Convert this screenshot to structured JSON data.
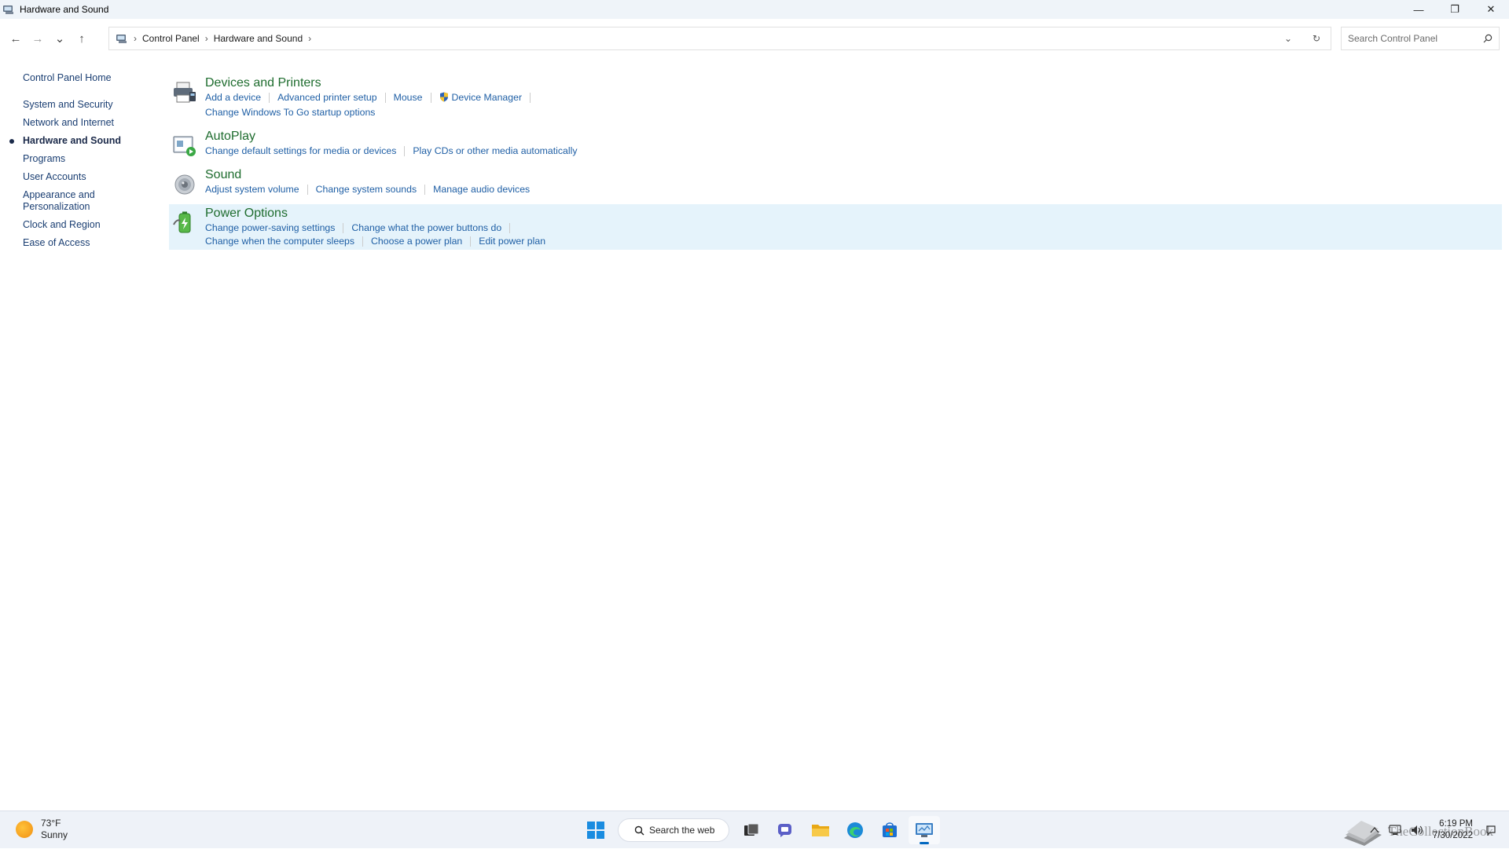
{
  "window": {
    "title": "Hardware and Sound",
    "controls": {
      "minimize": "—",
      "restore": "❐",
      "close": "✕"
    }
  },
  "nav": {
    "back": "←",
    "forward": "→",
    "recent": "⌄",
    "up": "↑",
    "breadcrumb": [
      "Control Panel",
      "Hardware and Sound"
    ],
    "dropdown": "⌄",
    "refresh": "↻",
    "search_placeholder": "Search Control Panel"
  },
  "sidebar": {
    "home": "Control Panel Home",
    "items": [
      {
        "label": "System and Security",
        "active": false
      },
      {
        "label": "Network and Internet",
        "active": false
      },
      {
        "label": "Hardware and Sound",
        "active": true
      },
      {
        "label": "Programs",
        "active": false
      },
      {
        "label": "User Accounts",
        "active": false
      },
      {
        "label": "Appearance and\nPersonalization",
        "active": false
      },
      {
        "label": "Clock and Region",
        "active": false
      },
      {
        "label": "Ease of Access",
        "active": false
      }
    ]
  },
  "categories": {
    "devices": {
      "title": "Devices and Printers",
      "links": [
        "Add a device",
        "Advanced printer setup",
        "Mouse",
        "Device Manager",
        "Change Windows To Go startup options"
      ]
    },
    "autoplay": {
      "title": "AutoPlay",
      "links": [
        "Change default settings for media or devices",
        "Play CDs or other media automatically"
      ]
    },
    "sound": {
      "title": "Sound",
      "links": [
        "Adjust system volume",
        "Change system sounds",
        "Manage audio devices"
      ]
    },
    "power": {
      "title": "Power Options",
      "links": [
        "Change power-saving settings",
        "Change what the power buttons do",
        "Change when the computer sleeps",
        "Choose a power plan",
        "Edit power plan"
      ]
    }
  },
  "taskbar": {
    "weather": {
      "temp": "73°F",
      "condition": "Sunny"
    },
    "search_label": "Search the web",
    "clock": {
      "time": "6:19 PM",
      "date": "7/30/2022"
    },
    "watermark": "TheCollectionBook"
  },
  "colors": {
    "category_title": "#1e6c2e",
    "link": "#1f5fa5",
    "sidebar_link": "#1a3e72",
    "highlight": "#e5f3fb",
    "accent": "#0067c0"
  }
}
